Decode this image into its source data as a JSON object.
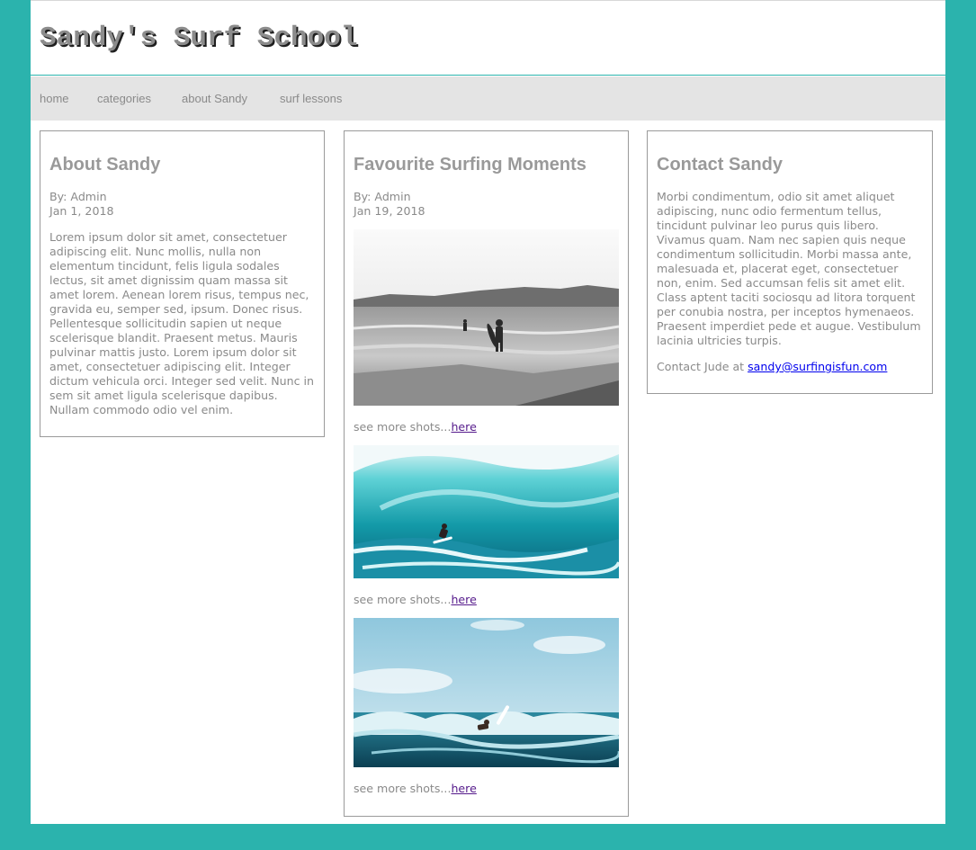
{
  "site": {
    "title": "Sandy's Surf School"
  },
  "nav": {
    "items": [
      "home",
      "categories",
      "about Sandy",
      "surf lessons"
    ]
  },
  "about": {
    "heading": "About Sandy",
    "author": "By: Admin",
    "date": "Jan 1, 2018",
    "text": "Lorem ipsum dolor sit amet, consectetuer adipiscing elit. Nunc mollis, nulla non elementum tincidunt, felis ligula sodales lectus, sit amet dignissim quam massa sit amet lorem. Aenean lorem risus, tempus nec, gravida eu, semper sed, ipsum. Donec risus. Pellentesque sollicitudin sapien ut neque scelerisque blandit. Praesent metus. Mauris pulvinar mattis justo. Lorem ipsum dolor sit amet, consectetuer adipiscing elit. Integer dictum vehicula orci. Integer sed velit. Nunc in sem sit amet ligula scelerisque dapibus. Nullam commodo odio vel enim."
  },
  "moments": {
    "heading": "Favourite Surfing Moments",
    "author": "By: Admin",
    "date": "Jan 19, 2018",
    "more_prefix": "see more shots...",
    "more_link": "here"
  },
  "contact": {
    "heading": "Contact Sandy",
    "text": "Morbi condimentum, odio sit amet aliquet adipiscing, nunc odio fermentum tellus, tincidunt pulvinar leo purus quis libero. Vivamus quam. Nam nec sapien quis neque condimentum sollicitudin. Morbi massa ante, malesuada et, placerat eget, consectetuer non, enim. Sed accumsan felis sit amet elit. Class aptent taciti sociosqu ad litora torquent per conubia nostra, per inceptos hymenaeos. Praesent imperdiet pede et augue. Vestibulum lacinia ultricies turpis.",
    "contact_prefix": "Contact Jude at ",
    "email": "sandy@surfingisfun.com"
  },
  "colors": {
    "background": "#2bb3ad",
    "nav_bg": "#e4e4e4",
    "text": "#8a8a8a",
    "link": "#0000ee",
    "visited": "#551a8b"
  }
}
